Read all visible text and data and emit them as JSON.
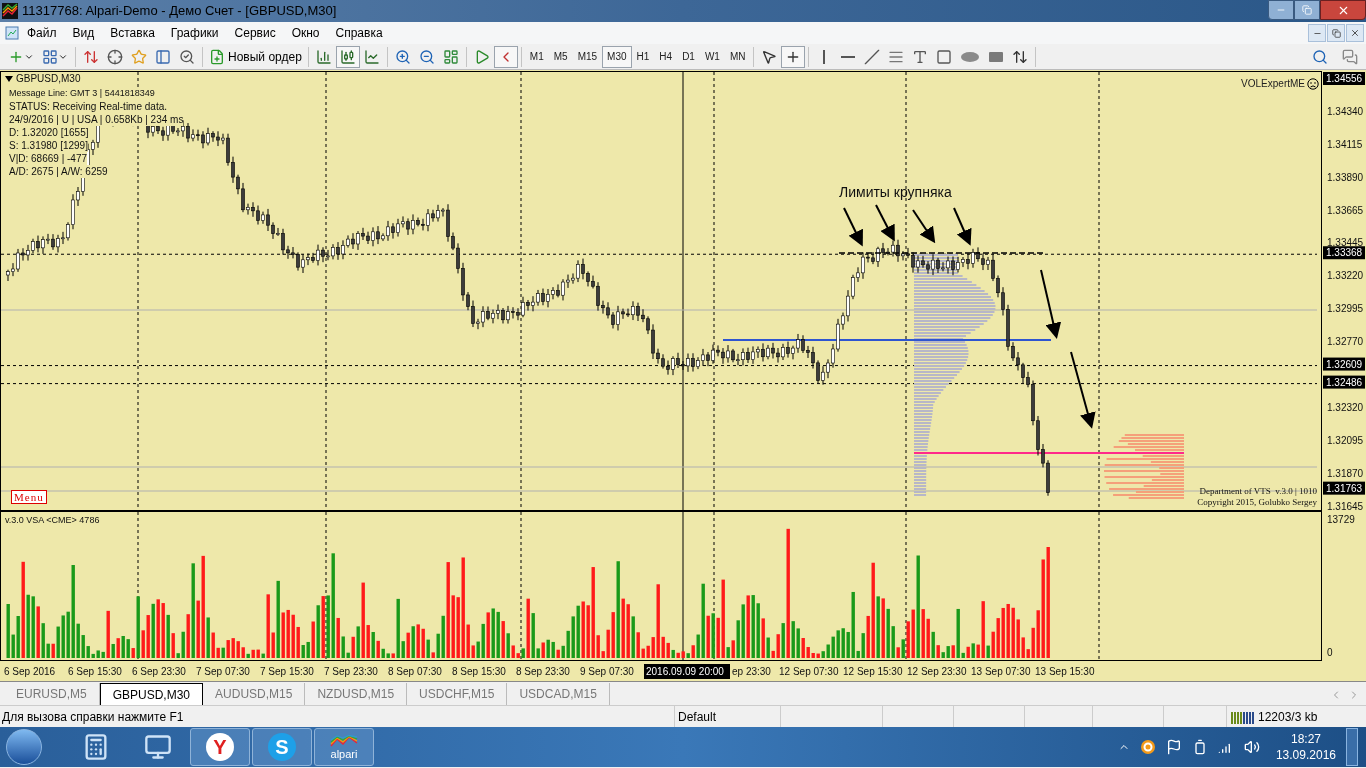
{
  "window": {
    "title": "11317768: Alpari-Demo - Демо Счет - [GBPUSD,M30]"
  },
  "menu": [
    "Файл",
    "Вид",
    "Вставка",
    "Графики",
    "Сервис",
    "Окно",
    "Справка"
  ],
  "toolbar": {
    "new_order": "Новый ордер",
    "chart_tools": [
      {
        "kind": "bars",
        "selected": false
      },
      {
        "kind": "candles",
        "selected": true
      },
      {
        "kind": "line",
        "selected": false
      },
      {
        "kind": "zoom-in",
        "selected": false
      },
      {
        "kind": "zoom-out",
        "selected": false
      },
      {
        "kind": "tile",
        "selected": false
      },
      {
        "kind": "autoscroll",
        "selected": false
      },
      {
        "kind": "shift",
        "selected": true
      }
    ],
    "timeframes": [
      {
        "label": "M1",
        "selected": false
      },
      {
        "label": "M5",
        "selected": false
      },
      {
        "label": "M15",
        "selected": false
      },
      {
        "label": "M30",
        "selected": true
      },
      {
        "label": "H1",
        "selected": false
      },
      {
        "label": "H4",
        "selected": false
      },
      {
        "label": "D1",
        "selected": false
      },
      {
        "label": "W1",
        "selected": false
      },
      {
        "label": "MN",
        "selected": false
      }
    ],
    "draw_tools": [
      {
        "kind": "cursor",
        "selected": false
      },
      {
        "kind": "crosshair",
        "selected": true
      },
      {
        "kind": "vline",
        "selected": false
      },
      {
        "kind": "hline",
        "selected": false
      },
      {
        "kind": "trend",
        "selected": false
      },
      {
        "kind": "fibo",
        "selected": false
      },
      {
        "kind": "text",
        "selected": false
      },
      {
        "kind": "label",
        "selected": false
      },
      {
        "kind": "ellipse",
        "selected": false
      },
      {
        "kind": "rect",
        "selected": false
      },
      {
        "kind": "arrows",
        "selected": false
      }
    ]
  },
  "chart": {
    "symbol": "GBPUSD,M30",
    "info_lines": [
      "Message Line: GMT 3 | 5441818349",
      "STATUS:  Receiving Real-time data.",
      "24/9/2016 | U | USA | 0.658Kb | 234 ms",
      "D: 1.32020  [1655]",
      "S: 1.31980  [1299]",
      "V|D: 68669 | -477",
      "A/D: 2675 | A/W: 6259"
    ],
    "expert": "VOLExpertME",
    "menu_button": "Menu",
    "annotation": "Лимиты крупняка",
    "footer_lines": [
      "Department of VTS  v.3.0 | 1010",
      "Copyright 2015, Golubko Sergey"
    ],
    "price_labels": [
      {
        "label": "1.34556",
        "kind": "marker"
      },
      {
        "label": "1.34340",
        "kind": "tick"
      },
      {
        "label": "1.34115",
        "kind": "tick"
      },
      {
        "label": "1.33890",
        "kind": "tick"
      },
      {
        "label": "1.33665",
        "kind": "tick"
      },
      {
        "label": "1.33445",
        "kind": "tick"
      },
      {
        "label": "1.33368",
        "kind": "marker"
      },
      {
        "label": "1.33220",
        "kind": "tick"
      },
      {
        "label": "1.32995",
        "kind": "tick"
      },
      {
        "label": "1.32770",
        "kind": "tick"
      },
      {
        "label": "1.32609",
        "kind": "marker"
      },
      {
        "label": "1.32486",
        "kind": "marker"
      },
      {
        "label": "1.32320",
        "kind": "tick"
      },
      {
        "label": "1.32095",
        "kind": "tick"
      },
      {
        "label": "1.31870",
        "kind": "tick"
      },
      {
        "label": "1.31763",
        "kind": "marker"
      },
      {
        "label": "1.31645",
        "kind": "tick"
      }
    ],
    "time_labels": [
      {
        "label": "6 Sep 2016",
        "kind": "tick"
      },
      {
        "label": "6 Sep 15:30",
        "kind": "tick"
      },
      {
        "label": "6 Sep 23:30",
        "kind": "tick"
      },
      {
        "label": "7 Sep 07:30",
        "kind": "tick"
      },
      {
        "label": "7 Sep 15:30",
        "kind": "tick"
      },
      {
        "label": "7 Sep 23:30",
        "kind": "tick"
      },
      {
        "label": "8 Sep 07:30",
        "kind": "tick"
      },
      {
        "label": "8 Sep 15:30",
        "kind": "tick"
      },
      {
        "label": "8 Sep 23:30",
        "kind": "tick"
      },
      {
        "label": "9 Sep 07:30",
        "kind": "tick"
      },
      {
        "label": "2016.09.09 20:00",
        "kind": "crosshair"
      },
      {
        "label": "ep 23:30",
        "kind": "partial"
      },
      {
        "label": "12 Sep 07:30",
        "kind": "tick"
      },
      {
        "label": "12 Sep 15:30",
        "kind": "tick"
      },
      {
        "label": "12 Sep 23:30",
        "kind": "tick"
      },
      {
        "label": "13 Sep 07:30",
        "kind": "tick"
      },
      {
        "label": "13 Sep 15:30",
        "kind": "tick"
      }
    ]
  },
  "volume": {
    "title": "v.3.0 VSA <CME> 4786",
    "max": "13729",
    "min": "0"
  },
  "tabs": [
    {
      "label": "EURUSD,M5",
      "selected": false
    },
    {
      "label": "GBPUSD,M30",
      "selected": true
    },
    {
      "label": "AUDUSD,M15",
      "selected": false
    },
    {
      "label": "NZDUSD,M15",
      "selected": false
    },
    {
      "label": "USDCHF,M15",
      "selected": false
    },
    {
      "label": "USDCAD,M15",
      "selected": false
    }
  ],
  "status_bar": {
    "help": "Для вызова справки нажмите F1",
    "profile": "Default",
    "traffic": "12203/3 kb"
  },
  "taskbar": {
    "apps": [
      {
        "kind": "calculator"
      },
      {
        "kind": "computer"
      },
      {
        "kind": "yandex",
        "glyph": "Y"
      },
      {
        "kind": "skype",
        "glyph": "S"
      },
      {
        "kind": "alpari",
        "label": "alpari"
      }
    ],
    "time": "18:27",
    "date": "13.09.2016"
  }
}
